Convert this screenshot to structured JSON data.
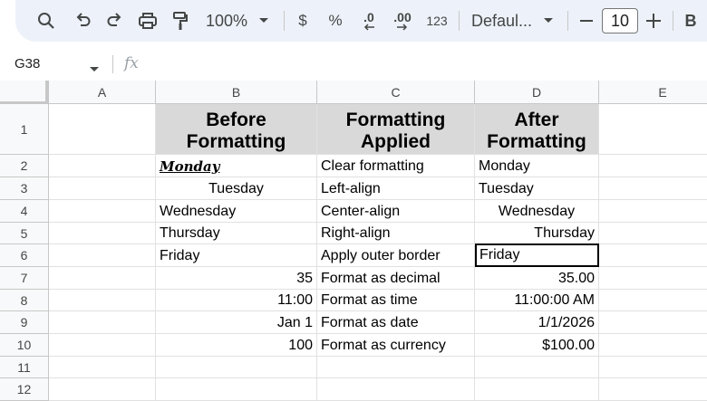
{
  "toolbar": {
    "zoom": "100%",
    "currency": "$",
    "percent": "%",
    "decrease_decimal": ".0",
    "increase_decimal": ".00",
    "number_format": "123",
    "font_name": "Defaul...",
    "font_size": "10",
    "bold": "B",
    "icons": [
      "search-icon",
      "undo-icon",
      "redo-icon",
      "print-icon",
      "paint-format-icon",
      "chevron-down-icon",
      "minus-icon",
      "plus-icon"
    ]
  },
  "formula_bar": {
    "name_box": "G38",
    "fx": "fx",
    "content": ""
  },
  "columns": [
    "A",
    "B",
    "C",
    "D",
    "E"
  ],
  "rows": [
    "1",
    "2",
    "3",
    "4",
    "5",
    "6",
    "7",
    "8",
    "9",
    "10",
    "11",
    "12"
  ],
  "cells": {
    "B1": "Before Formatting",
    "C1": "Formatting Applied",
    "D1": "After Formatting",
    "B2": "Monday",
    "C2": "Clear formatting",
    "D2": "Monday",
    "B3": "Tuesday",
    "C3": "Left-align",
    "D3": "Tuesday",
    "B4": "Wednesday",
    "C4": "Center-align",
    "D4": "Wednesday",
    "B5": "Thursday",
    "C5": "Right-align",
    "D5": "Thursday",
    "B6": "Friday",
    "C6": "Apply outer border",
    "D6": "Friday",
    "B7": "35",
    "C7": "Format as decimal",
    "D7": "35.00",
    "B8": "11:00",
    "C8": "Format as time",
    "D8": "11:00:00 AM",
    "B9": "Jan 1",
    "C9": "Format as date",
    "D9": "1/1/2026",
    "B10": "100",
    "C10": "Format as currency",
    "D10": "$100.00"
  },
  "colors": {
    "toolbar_bg": "#edf2fa",
    "header_fill": "#d9d9d9",
    "gridline": "#e1e1e1"
  }
}
